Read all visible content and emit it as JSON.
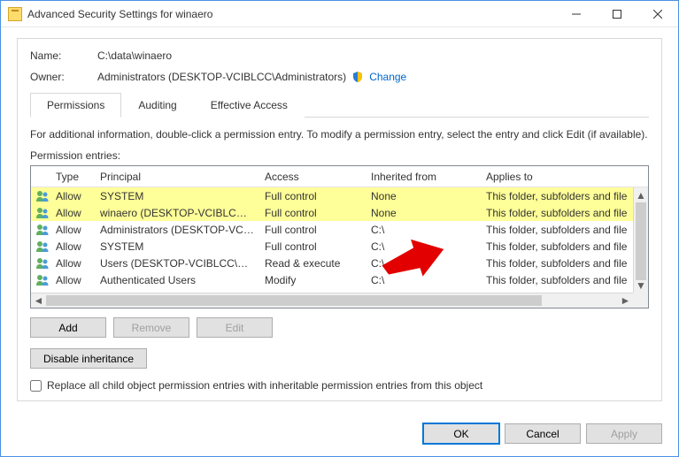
{
  "titlebar": {
    "title": "Advanced Security Settings for winaero"
  },
  "info": {
    "name_label": "Name:",
    "name_value": "C:\\data\\winaero",
    "owner_label": "Owner:",
    "owner_value": "Administrators (DESKTOP-VCIBLCC\\Administrators)",
    "change_link": "Change"
  },
  "tabs": {
    "permissions": "Permissions",
    "auditing": "Auditing",
    "effective": "Effective Access"
  },
  "hint": "For additional information, double-click a permission entry. To modify a permission entry, select the entry and click Edit (if available).",
  "entries_label": "Permission entries:",
  "columns": {
    "type": "Type",
    "principal": "Principal",
    "access": "Access",
    "inherited": "Inherited from",
    "applies": "Applies to"
  },
  "entries": [
    {
      "type": "Allow",
      "principal": "SYSTEM",
      "access": "Full control",
      "inherited": "None",
      "applies": "This folder, subfolders and file",
      "hl": true
    },
    {
      "type": "Allow",
      "principal": "winaero (DESKTOP-VCIBLCC\\...",
      "access": "Full control",
      "inherited": "None",
      "applies": "This folder, subfolders and file",
      "hl": true
    },
    {
      "type": "Allow",
      "principal": "Administrators (DESKTOP-VCI...",
      "access": "Full control",
      "inherited": "C:\\",
      "applies": "This folder, subfolders and file",
      "hl": false
    },
    {
      "type": "Allow",
      "principal": "SYSTEM",
      "access": "Full control",
      "inherited": "C:\\",
      "applies": "This folder, subfolders and file",
      "hl": false
    },
    {
      "type": "Allow",
      "principal": "Users (DESKTOP-VCIBLCC\\Us...",
      "access": "Read & execute",
      "inherited": "C:\\",
      "applies": "This folder, subfolders and file",
      "hl": false
    },
    {
      "type": "Allow",
      "principal": "Authenticated Users",
      "access": "Modify",
      "inherited": "C:\\",
      "applies": "This folder, subfolders and file",
      "hl": false
    }
  ],
  "buttons": {
    "add": "Add",
    "remove": "Remove",
    "edit": "Edit",
    "disable": "Disable inheritance",
    "ok": "OK",
    "cancel": "Cancel",
    "apply": "Apply"
  },
  "checkbox_label": "Replace all child object permission entries with inheritable permission entries from this object"
}
